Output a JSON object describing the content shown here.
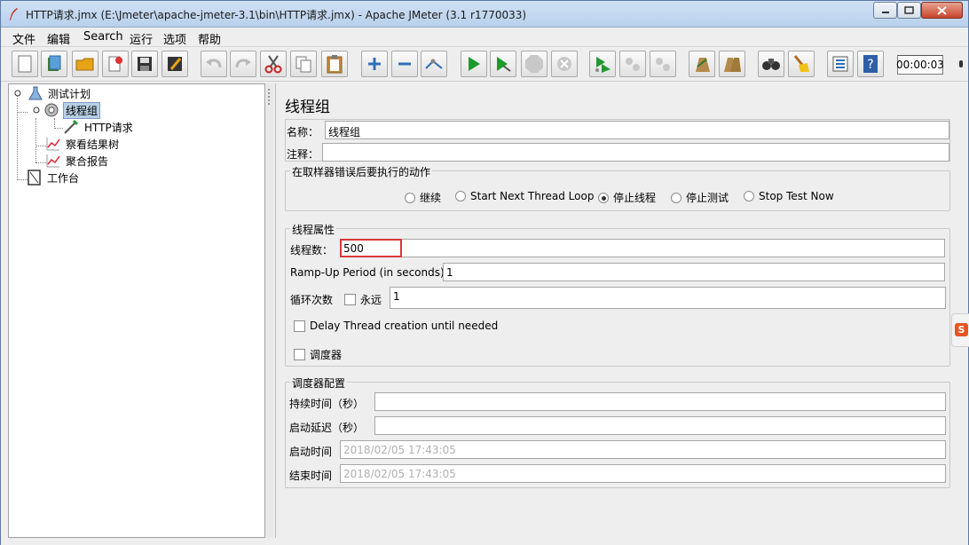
{
  "window": {
    "title": "HTTP请求.jmx (E:\\Jmeter\\apache-jmeter-3.1\\bin\\HTTP请求.jmx) - Apache JMeter (3.1 r1770033)"
  },
  "menu": {
    "items": [
      "文件",
      "编辑",
      "Search",
      "运行",
      "选项",
      "帮助"
    ]
  },
  "toolbar": {
    "timer": "00:00:03",
    "buttons": [
      "new-icon",
      "templates-icon",
      "open-icon",
      "close-plan-icon",
      "save-icon",
      "save-as-icon",
      "undo-icon",
      "redo-icon",
      "cut-icon",
      "copy-icon",
      "paste-icon",
      "expand-icon",
      "collapse-icon",
      "toggle-icon",
      "start-icon",
      "start-no-pause-icon",
      "stop-icon",
      "shutdown-icon",
      "remote-start-icon",
      "remote-stop-icon",
      "remote-shutdown-icon",
      "clear-icon",
      "clear-all-icon",
      "search-icon",
      "reset-search-icon",
      "function-helper-icon",
      "help-icon"
    ]
  },
  "tree": {
    "nodes": [
      {
        "label": "测试计划",
        "icon": "test-plan-icon"
      },
      {
        "label": "线程组",
        "icon": "thread-group-icon",
        "selected": true
      },
      {
        "label": "HTTP请求",
        "icon": "http-sampler-icon"
      },
      {
        "label": "察看结果树",
        "icon": "listener-icon"
      },
      {
        "label": "聚合报告",
        "icon": "listener-icon"
      },
      {
        "label": "工作台",
        "icon": "workbench-icon"
      }
    ]
  },
  "form": {
    "title": "线程组",
    "name_label": "名称：",
    "name_value": "线程组",
    "comment_label": "注释：",
    "comment_value": "",
    "on_error": {
      "legend": "在取样器错误后要执行的动作",
      "options": [
        "继续",
        "Start Next Thread Loop",
        "停止线程",
        "停止测试",
        "Stop Test Now"
      ],
      "selected": "停止线程"
    },
    "thread_props": {
      "legend": "线程属性",
      "threads_label": "线程数：",
      "threads_value": "500",
      "rampup_label": "Ramp-Up Period (in seconds):",
      "rampup_value": "1",
      "loop_label": "循环次数",
      "forever_label": "永远",
      "loop_value": "1",
      "delay_label": "Delay Thread creation until needed",
      "scheduler_label": "调度器"
    },
    "scheduler_config": {
      "legend": "调度器配置",
      "duration_label": "持续时间（秒）",
      "duration_value": "",
      "startup_delay_label": "启动延迟（秒）",
      "startup_delay_value": "",
      "start_time_label": "启动时间",
      "start_time_value": "2018/02/05 17:43:05",
      "end_time_label": "结束时间",
      "end_time_value": "2018/02/05 17:43:05"
    }
  },
  "side_widget": {
    "label": "S"
  }
}
